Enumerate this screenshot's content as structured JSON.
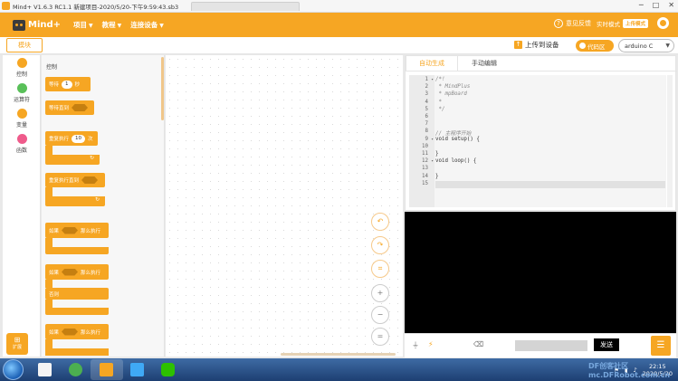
{
  "titlebar": {
    "title": "Mind+ V1.6.3 RC1.1  新建项目-2020/5/20-下午9:59:43.sb3",
    "minimize": "─",
    "maximize": "□",
    "close": "✕"
  },
  "header": {
    "logo_text": "Mind+",
    "menus": [
      {
        "label": "项目"
      },
      {
        "label": "教程"
      },
      {
        "label": "连接设备"
      }
    ],
    "feedback": "意见反馈",
    "mode_realtime": "实时模式",
    "mode_upload": "上传模式"
  },
  "tabs": {
    "module": "模块",
    "upload": "上传到设备",
    "code_area": "代码区",
    "board": "arduino C"
  },
  "categories": [
    {
      "label": "控制",
      "color": "#f6a623"
    },
    {
      "label": "运算符",
      "color": "#59c059"
    },
    {
      "label": "变量",
      "color": "#f6a623"
    },
    {
      "label": "函数",
      "color": "#ef5b8b"
    }
  ],
  "extension": "扩展",
  "palette": {
    "title": "控制",
    "blocks": {
      "wait_pre": "等待",
      "wait_val": "1",
      "wait_post": "秒",
      "wait_until": "等待直到",
      "repeat_pre": "重复执行",
      "repeat_val": "10",
      "repeat_post": "次",
      "repeat_until": "重复执行直到",
      "if1": "如果",
      "then1": "那么执行",
      "if2": "如果",
      "then2": "那么执行",
      "else2": "否则",
      "if3": "如果",
      "then3": "那么执行",
      "loop_arrow": "↻"
    }
  },
  "code": {
    "tab_auto": "自动生成",
    "tab_manual": "手动编辑",
    "lines": [
      {
        "n": "1",
        "text": "/*!",
        "cm": true
      },
      {
        "n": "2",
        "text": " * MindPlus",
        "cm": true
      },
      {
        "n": "3",
        "text": " * mpBoard",
        "cm": true
      },
      {
        "n": "4",
        "text": " *",
        "cm": true
      },
      {
        "n": "5",
        "text": " */",
        "cm": true
      },
      {
        "n": "6",
        "text": "",
        "cm": false
      },
      {
        "n": "7",
        "text": "",
        "cm": false
      },
      {
        "n": "8",
        "text": "// 主程序开始",
        "cm": true
      },
      {
        "n": "9",
        "text": "void setup() {",
        "cm": false
      },
      {
        "n": "10",
        "text": "",
        "cm": false
      },
      {
        "n": "11",
        "text": "}",
        "cm": false
      },
      {
        "n": "12",
        "text": "void loop() {",
        "cm": false
      },
      {
        "n": "13",
        "text": "",
        "cm": false
      },
      {
        "n": "14",
        "text": "}",
        "cm": false
      },
      {
        "n": "15",
        "text": "",
        "cm": false
      }
    ]
  },
  "serial": {
    "send": "发送",
    "menu_icon": "☰"
  },
  "taskbar": {
    "time": "22:15",
    "date": "2020/5/20"
  },
  "watermark": "DF创客社区 mc.DFRobot.com.cn"
}
